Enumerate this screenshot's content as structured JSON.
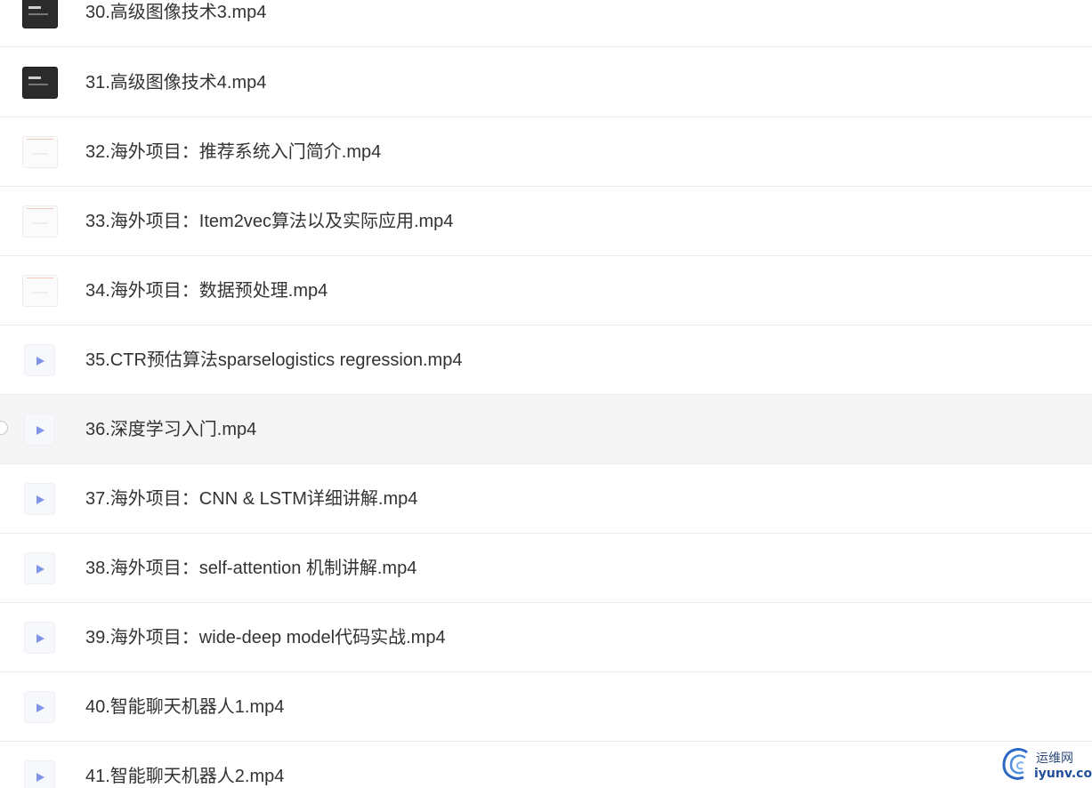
{
  "files": [
    {
      "name": "30.高级图像技术3.mp4",
      "thumbnail": "dark"
    },
    {
      "name": "31.高级图像技术4.mp4",
      "thumbnail": "dark"
    },
    {
      "name": "32.海外项目：推荐系统入门简介.mp4",
      "thumbnail": "light"
    },
    {
      "name": "33.海外项目：Item2vec算法以及实际应用.mp4",
      "thumbnail": "light"
    },
    {
      "name": "34.海外项目：数据预处理.mp4",
      "thumbnail": "light"
    },
    {
      "name": "35.CTR预估算法sparselogistics regression.mp4",
      "thumbnail": "video-icon"
    },
    {
      "name": "36.深度学习入门.mp4",
      "thumbnail": "video-icon",
      "hovered": true
    },
    {
      "name": "37.海外项目：CNN & LSTM详细讲解.mp4",
      "thumbnail": "video-icon"
    },
    {
      "name": "38.海外项目：self-attention 机制讲解.mp4",
      "thumbnail": "video-icon"
    },
    {
      "name": "39.海外项目：wide-deep model代码实战.mp4",
      "thumbnail": "video-icon"
    },
    {
      "name": "40.智能聊天机器人1.mp4",
      "thumbnail": "video-icon"
    },
    {
      "name": "41.智能聊天机器人2.mp4",
      "thumbnail": "video-icon"
    }
  ],
  "watermark": {
    "line1": "运维网",
    "line2": "iyunv.com",
    "logo_icon": "swirl-logo-icon"
  },
  "colors": {
    "text": "#333333",
    "hover_bg": "#f5f5f5",
    "play_icon": "#7f95e8",
    "divider": "#ececec"
  }
}
